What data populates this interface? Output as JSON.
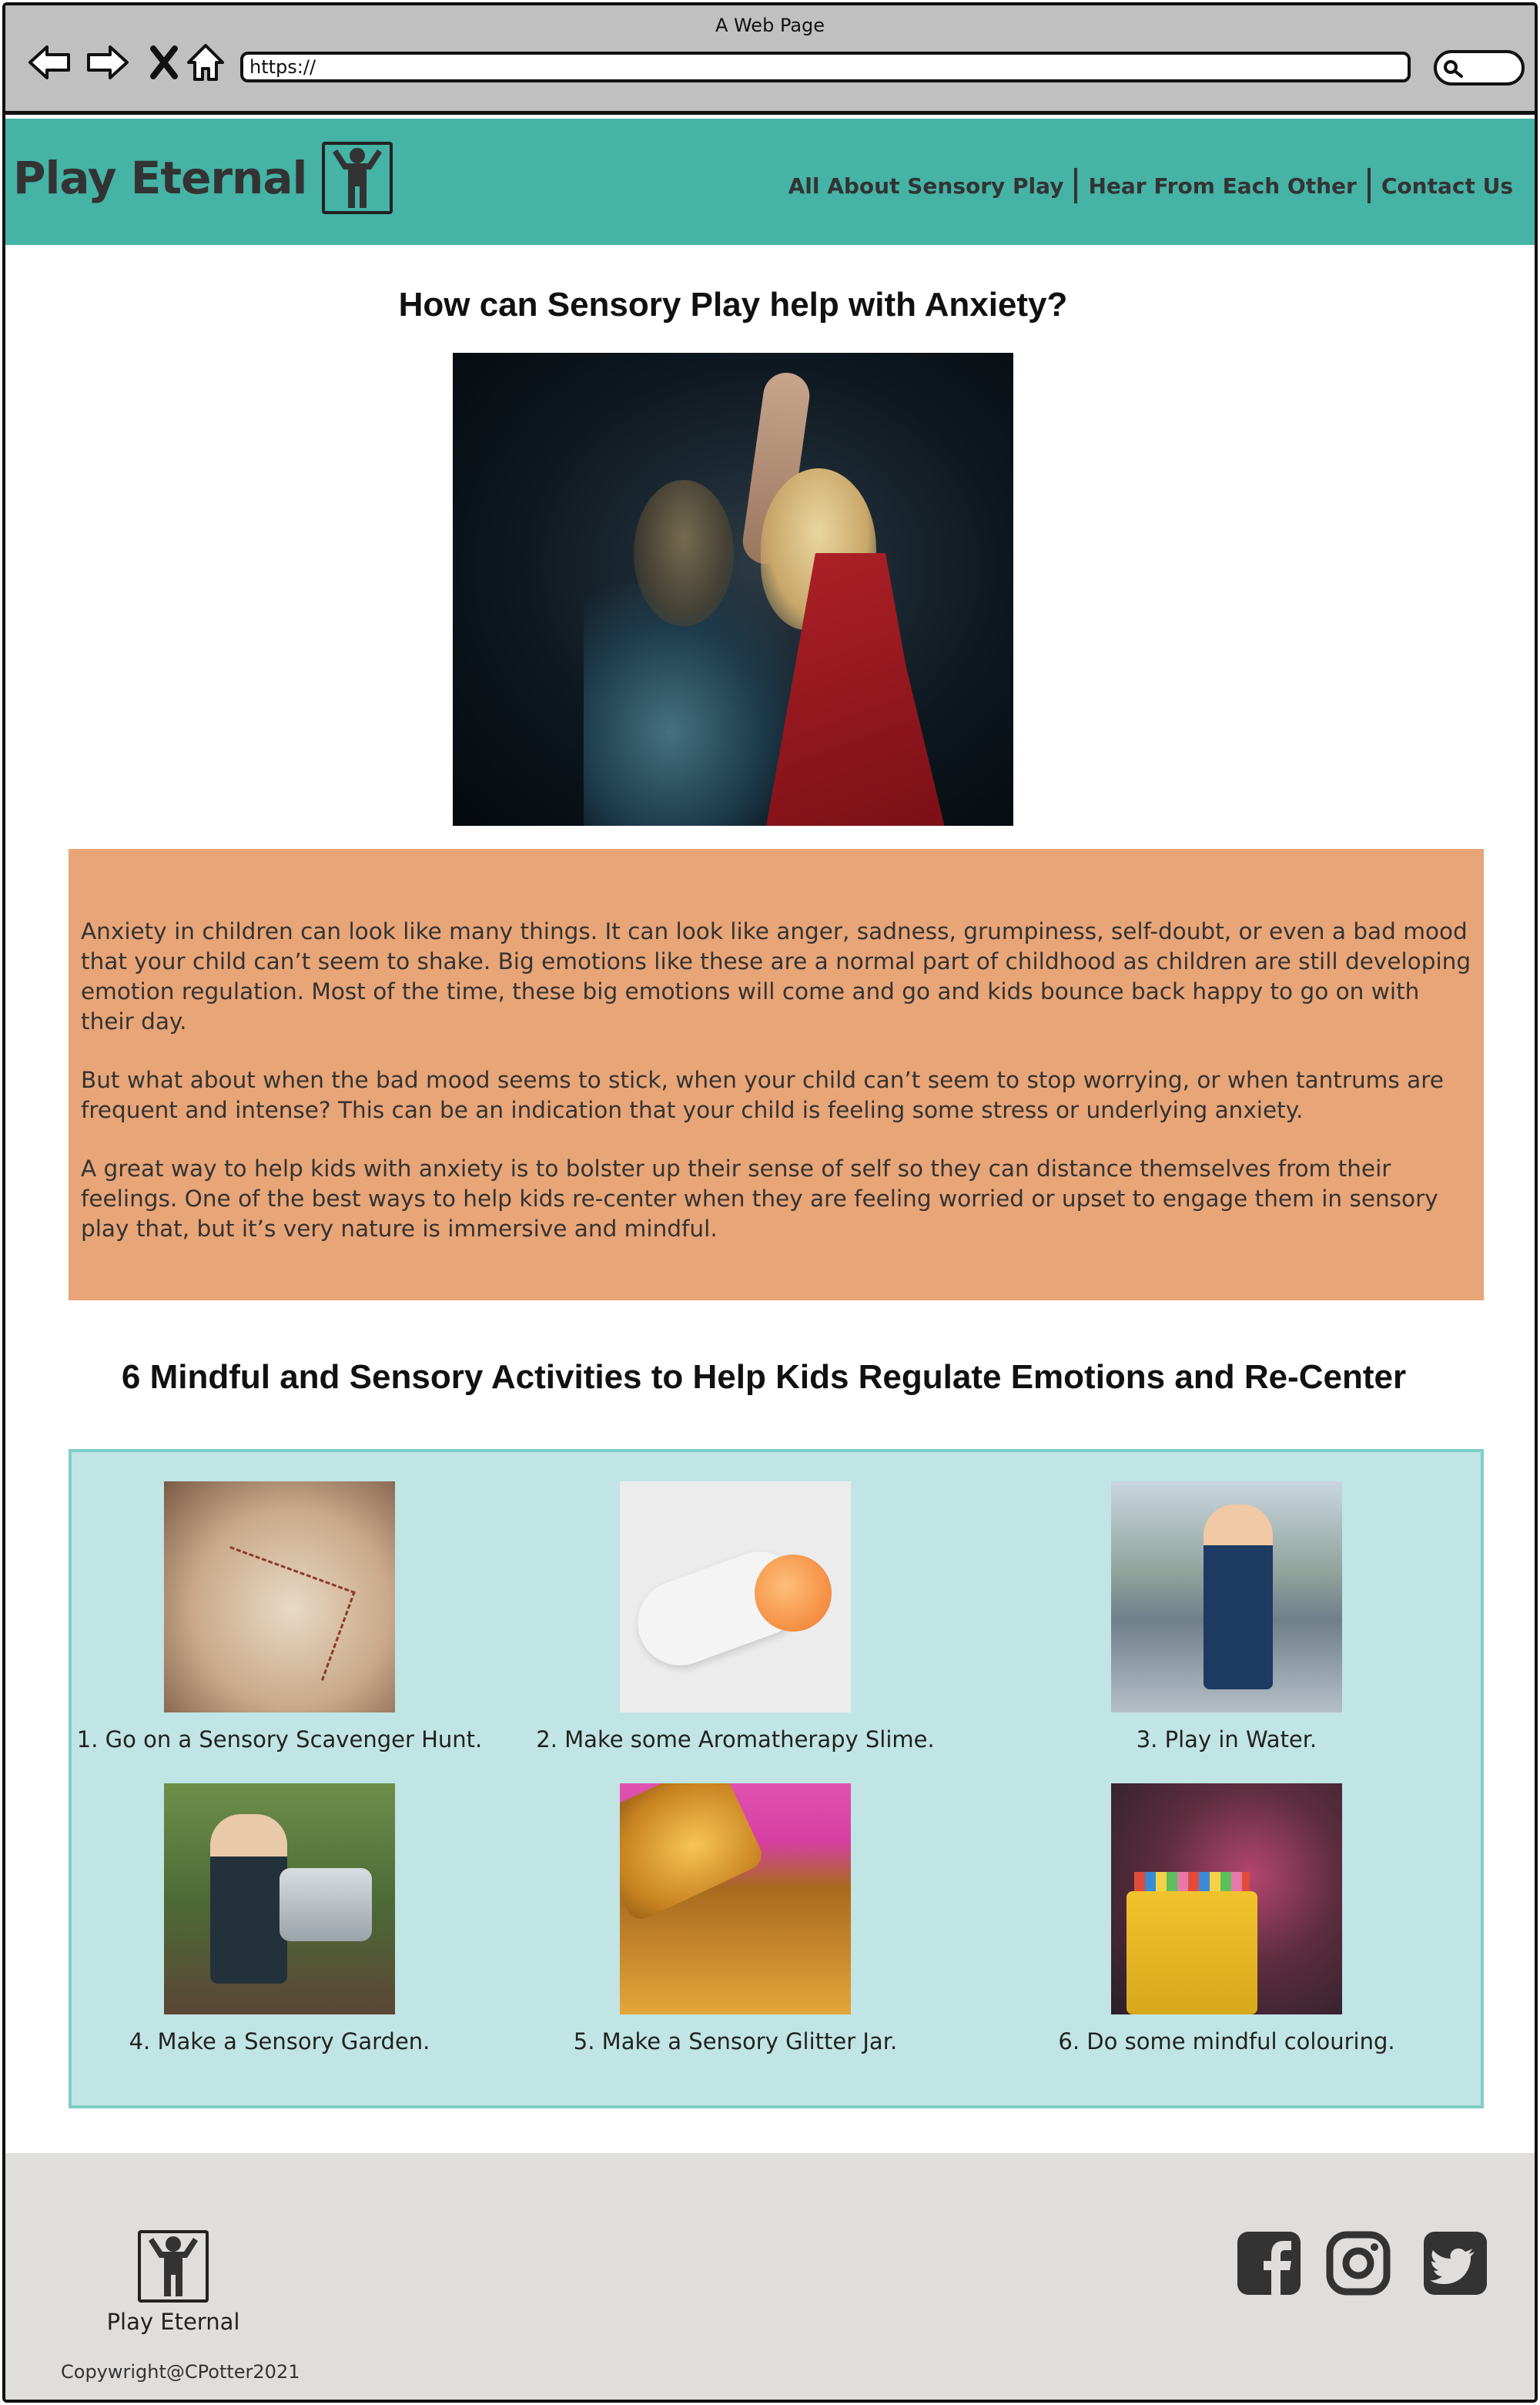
{
  "browser": {
    "title": "A Web Page",
    "url": "https://"
  },
  "header": {
    "brand": "Play Eternal",
    "nav": [
      {
        "label": "All About Sensory Play"
      },
      {
        "label": "Hear From Each Other"
      },
      {
        "label": "Contact Us"
      }
    ]
  },
  "main": {
    "heading": "How can Sensory Play help with Anxiety?",
    "paragraphs": [
      "Anxiety in children can look like many things. It can look like anger, sadness, grumpiness, self-doubt, or even a bad mood that your child can’t seem to shake. Big emotions like these are a normal part of childhood as children are still developing emotion regulation. Most of the time, these big emotions will come and go and kids bounce back happy to go on with their day.",
      "But what about when the bad mood seems to stick, when your child can’t seem to stop worrying, or when tantrums are frequent and intense? This can be an indication that your child is feeling some stress or underlying anxiety.",
      "A great way to help kids with anxiety is to bolster up their sense of self so they can distance themselves from their feelings. One of the best ways to help kids re-center when they are feeling worried or upset to engage them in sensory play that, but it’s very nature is immersive and mindful."
    ],
    "activities_heading": "6 Mindful and Sensory Activities to Help Kids Regulate Emotions and Re-Center",
    "activities": [
      {
        "caption": "1. Go on a Sensory Scavenger Hunt."
      },
      {
        "caption": "2. Make some Aromatherapy Slime."
      },
      {
        "caption": "3. Play in Water."
      },
      {
        "caption": "4. Make a Sensory Garden."
      },
      {
        "caption": "5. Make a Sensory Glitter Jar."
      },
      {
        "caption": "6. Do some mindful colouring."
      }
    ]
  },
  "footer": {
    "brand": "Play Eternal",
    "copyright": "Copywright@CPotter2021",
    "social": [
      "facebook-icon",
      "instagram-icon",
      "twitter-icon"
    ]
  },
  "colors": {
    "header_bg": "#45b3a6",
    "intro_bg": "#e8a577",
    "activities_bg": "#c0e5e4",
    "footer_bg": "#e0dedd"
  }
}
